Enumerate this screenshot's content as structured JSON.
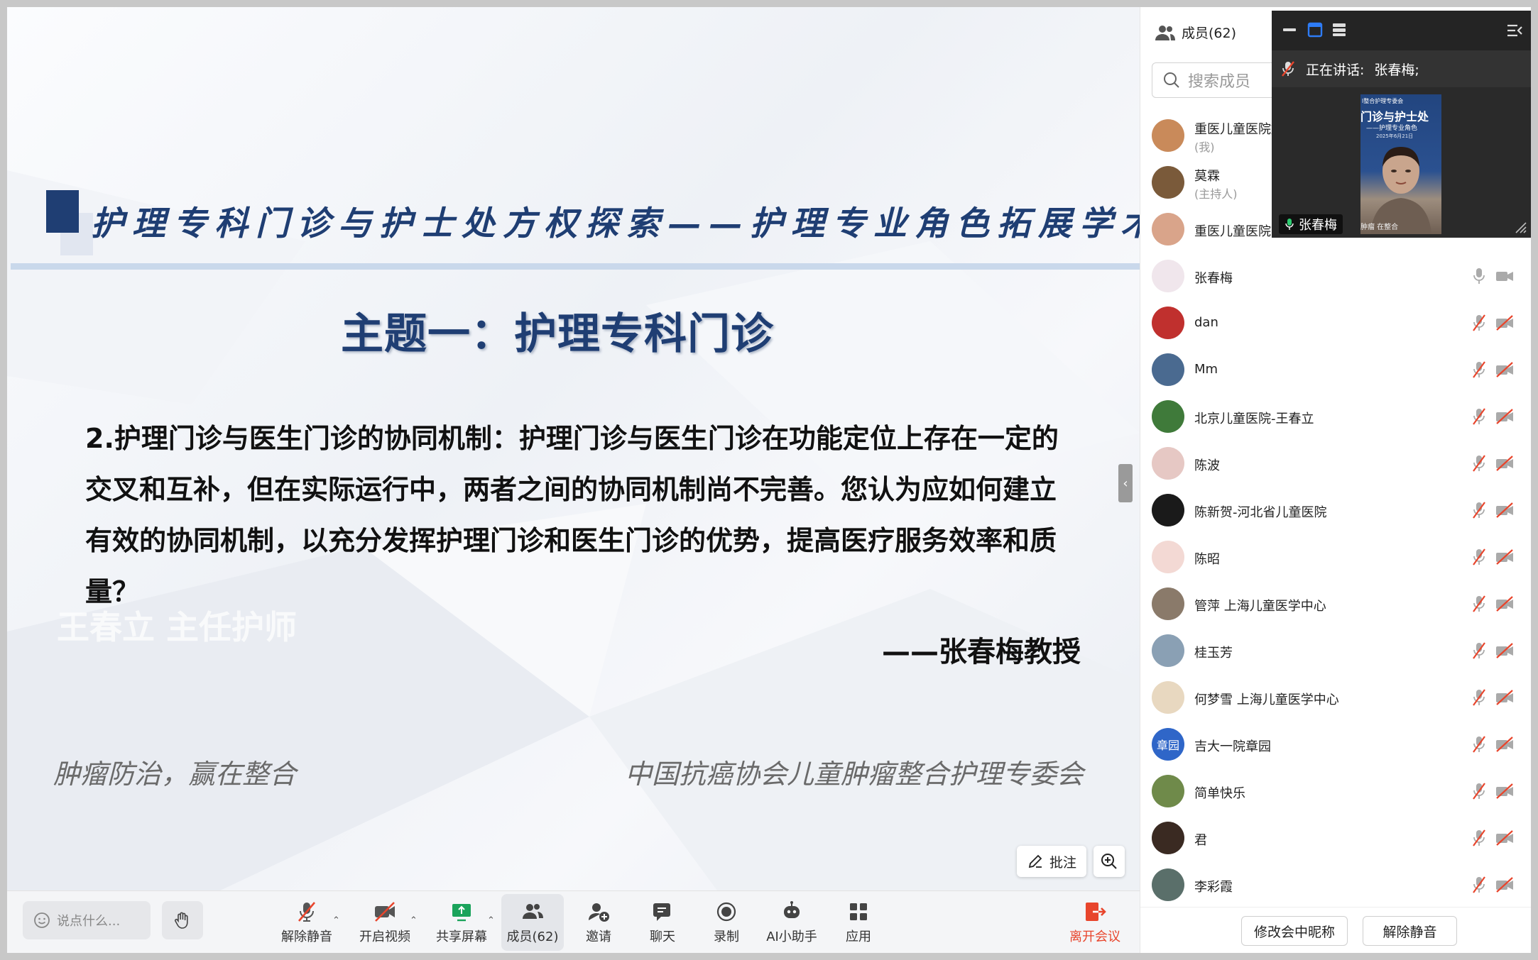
{
  "slide": {
    "title": "护理专科门诊与护士处方权探索——护理专业角色拓展学术沙龙",
    "topic": "主题一：护理专科门诊",
    "question": "2.护理门诊与医生门诊的协同机制：护理门诊与医生门诊在功能定位上存在一定的交叉和互补，但在实际运行中，两者之间的协同机制尚不完善。您认为应如何建立有效的协同机制，以充分发挥护理门诊和医生门诊的优势，提高医疗服务效率和质量？",
    "ghost_text": "王春立  主任护师",
    "author": "——张春梅教授",
    "footer_left": "肿瘤防治，赢在整合",
    "footer_right": "中国抗癌协会儿童肿瘤整合护理专委会"
  },
  "controls": {
    "annotate": "批注",
    "collapse": "‹"
  },
  "toolbar": {
    "chat_placeholder": "说点什么...",
    "unmute": "解除静音",
    "start_video": "开启视频",
    "share_screen": "共享屏幕",
    "members": "成员(62)",
    "invite": "邀请",
    "chat": "聊天",
    "record": "录制",
    "ai_assistant": "AI小助手",
    "apps": "应用",
    "leave": "离开会议"
  },
  "panel": {
    "header": "成员(62)",
    "search_placeholder": "搜索成员",
    "members": [
      {
        "name": "重医儿童医院姚",
        "role": "(我)",
        "avatar_color": "#c98a5a",
        "mic": "off",
        "cam": "off"
      },
      {
        "name": "莫霖",
        "role": "(主持人)",
        "avatar_color": "#7a5a3a",
        "mic": "off",
        "cam": "off"
      },
      {
        "name": "重医儿童医院刘",
        "role": "",
        "avatar_color": "#d9a48a",
        "mic": "off",
        "cam": "off"
      },
      {
        "name": "张春梅",
        "role": "",
        "avatar_color": "#f0e6ec",
        "mic": "on",
        "cam": "on"
      },
      {
        "name": "dan",
        "role": "",
        "avatar_color": "#c0302e",
        "mic": "off",
        "cam": "off"
      },
      {
        "name": "Mm",
        "role": "",
        "avatar_color": "#4a6a90",
        "mic": "off",
        "cam": "off"
      },
      {
        "name": "北京儿童医院-王春立",
        "role": "",
        "avatar_color": "#3f7a3a",
        "mic": "off",
        "cam": "off"
      },
      {
        "name": "陈波",
        "role": "",
        "avatar_color": "#e6c8c4",
        "mic": "off",
        "cam": "off"
      },
      {
        "name": "陈新贺-河北省儿童医院",
        "role": "",
        "avatar_color": "#1a1a1a",
        "mic": "off",
        "cam": "off"
      },
      {
        "name": "陈昭",
        "role": "",
        "avatar_color": "#f3d9d4",
        "mic": "off",
        "cam": "off"
      },
      {
        "name": "管萍 上海儿童医学中心",
        "role": "",
        "avatar_color": "#8a7a6a",
        "mic": "off",
        "cam": "off"
      },
      {
        "name": "桂玉芳",
        "role": "",
        "avatar_color": "#8aa0b4",
        "mic": "off",
        "cam": "off"
      },
      {
        "name": "何梦雪 上海儿童医学中心",
        "role": "",
        "avatar_color": "#e8d8c0",
        "mic": "off",
        "cam": "off"
      },
      {
        "name": "吉大一院章园",
        "role": "",
        "avatar_color": "#2f66c8",
        "avatar_text": "章园",
        "mic": "off",
        "cam": "off"
      },
      {
        "name": "简单快乐",
        "role": "",
        "avatar_color": "#6f8a4a",
        "mic": "off",
        "cam": "off"
      },
      {
        "name": "君",
        "role": "",
        "avatar_color": "#3a2a22",
        "mic": "off",
        "cam": "off"
      },
      {
        "name": "李彩霞",
        "role": "",
        "avatar_color": "#5a6f6a",
        "mic": "off",
        "cam": "off"
      }
    ],
    "edit_nickname": "修改会中昵称",
    "unmute": "解除静音"
  },
  "video": {
    "speaking_label": "正在讲话:",
    "speaking_name": "张春梅;",
    "speaker_name": "张春梅",
    "mini_slide_line1": "l整合护理专委会",
    "mini_slide_line2": "门诊与护士处",
    "mini_slide_line3": "——护理专业角色",
    "mini_slide_date": "2025年6月21日",
    "mini_slide_footer": "肿瘤            在整合"
  },
  "colors": {
    "slide_title": "#1f3e73",
    "leave": "#e8452c",
    "active_blue": "#2e7cf6"
  }
}
